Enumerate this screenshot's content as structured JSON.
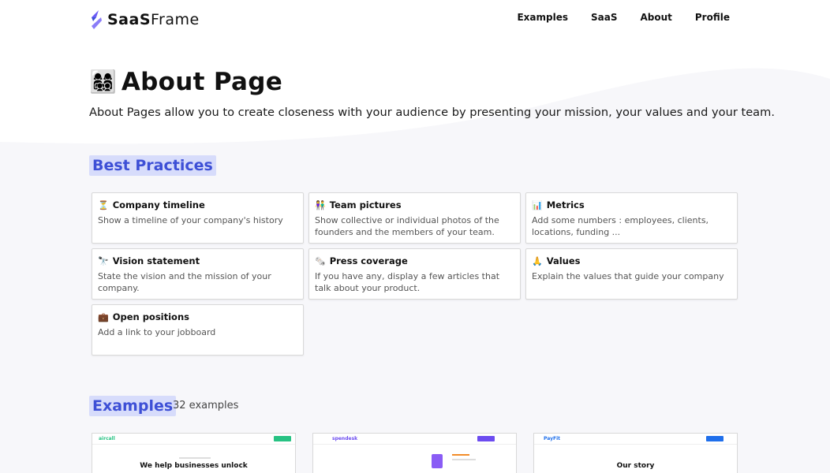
{
  "nav": {
    "brand_bold": "SaaS",
    "brand_light": "Frame",
    "links": [
      "Examples",
      "SaaS",
      "About",
      "Profile"
    ]
  },
  "hero": {
    "emoji": "👩‍👩‍👧‍👦",
    "title": "About Page",
    "subtitle": "About Pages allow you to create closeness with your audience by presenting your mission, your values and your team."
  },
  "best_practices": {
    "heading": "Best Practices",
    "cards": [
      {
        "icon": "⏳",
        "title": "Company timeline",
        "desc": "Show a timeline of your company's history"
      },
      {
        "icon": "👫",
        "title": "Team pictures",
        "desc": "Show collective or individual photos of the founders and the members of your team."
      },
      {
        "icon": "📊",
        "title": "Metrics",
        "desc": "Add some numbers : employees, clients, locations, funding ..."
      },
      {
        "icon": "🔭",
        "title": "Vision statement",
        "desc": "State the vision and the mission of your company."
      },
      {
        "icon": "🗞️",
        "title": "Press coverage",
        "desc": "If you have any, display a few articles that talk about your product."
      },
      {
        "icon": "🙏",
        "title": "Values",
        "desc": "Explain the values that guide your company"
      },
      {
        "icon": "💼",
        "title": "Open positions",
        "desc": "Add a link to your jobboard"
      }
    ]
  },
  "examples": {
    "heading": "Examples",
    "count": "32 examples",
    "shots": [
      {
        "logo": "aircall",
        "headline": "We help businesses unlock",
        "accent": "#27c283"
      },
      {
        "logo": "spendesk",
        "headline": "",
        "accent": "#6c4cf0"
      },
      {
        "logo": "PayFit",
        "headline": "Our story",
        "accent": "#1f6feb"
      }
    ]
  },
  "colors": {
    "accent": "#3d4fd6",
    "heading_bg": "#d7dcfb"
  }
}
